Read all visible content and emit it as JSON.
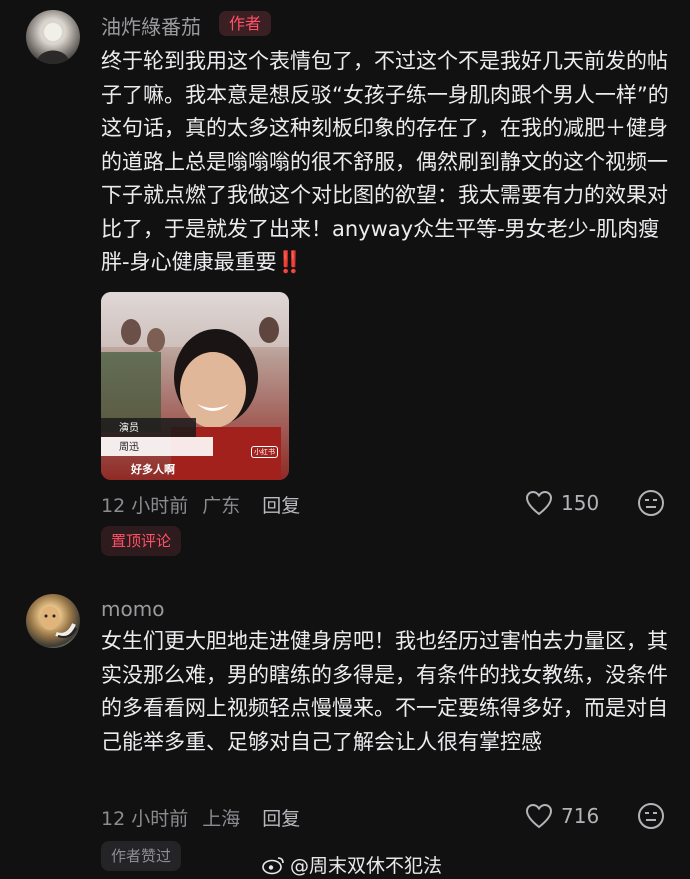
{
  "comments": [
    {
      "username": "油炸綠番茄",
      "badge": "作者",
      "text": "终于轮到我用这个表情包了，不过这个不是我好几天前发的帖子了嘛。我本意是想反驳“女孩子练一身肌肉跟个男人一样”的这句话，真的太多这种刻板印象的存在了，在我的减肥＋健身的道路上总是嗡嗡嗡的很不舒服，偶然刷到静文的这个视频一下子就点燃了我做这个对比图的欲望：我太需要有力的效果对比了，于是就发了出来！anyway众生平等-男女老少-肌肉瘦胖-身心健康最重要",
      "emoji": "‼️",
      "thumb": {
        "caption_top": "演员",
        "caption_name": "周迅",
        "caption_bottom": "好多人啊",
        "logo": "小红书"
      },
      "time": "12 小时前",
      "location": "广东",
      "reply": "回复",
      "likes": "150",
      "tag": "置顶评论"
    },
    {
      "username": "momo",
      "text": "女生们更大胆地走进健身房吧！我也经历过害怕去力量区，其实没那么难，男的瞎练的多得是，有条件的找女教练，没条件的多看看网上视频轻点慢慢来。不一定要练得多好，而是对自己能举多重、足够对自己了解会让人很有掌控感",
      "time": "12 小时前",
      "location": "上海",
      "reply": "回复",
      "likes": "716",
      "tag": "作者赞过"
    }
  ],
  "watermark": "@周末双休不犯法",
  "colors": {
    "background": "#111112",
    "accent": "#ff5168",
    "muted": "#8b8b90"
  },
  "icons": [
    "heart-icon",
    "neutral-face-icon",
    "weibo-icon"
  ]
}
